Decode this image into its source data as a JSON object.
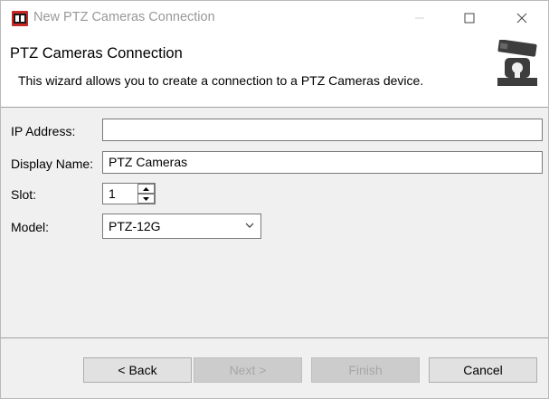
{
  "window": {
    "title": "New PTZ Cameras Connection"
  },
  "banner": {
    "title": "PTZ Cameras Connection",
    "description": "This wizard allows you to create a connection to a PTZ Cameras device.",
    "icon": "ptz-camera-icon"
  },
  "form": {
    "ip_address": {
      "label": "IP Address:",
      "value": ""
    },
    "display_name": {
      "label": "Display Name:",
      "value": "PTZ Cameras"
    },
    "slot": {
      "label": "Slot:",
      "value": "1"
    },
    "model": {
      "label": "Model:",
      "value": "PTZ-12G"
    }
  },
  "buttons": {
    "back": "< Back",
    "next": "Next >",
    "finish": "Finish",
    "cancel": "Cancel"
  },
  "colors": {
    "title_text": "#999999",
    "disabled_text": "#a6a6a6",
    "button_bg": "#e1e1e1",
    "dialog_bg": "#f0f0f0"
  }
}
